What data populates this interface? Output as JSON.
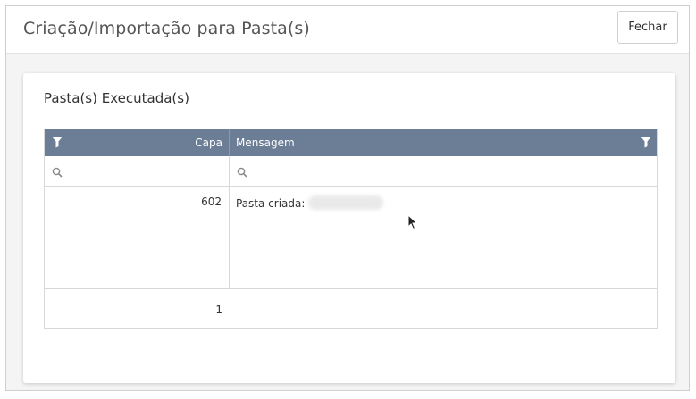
{
  "modal": {
    "title": "Criação/Importação para Pasta(s)",
    "close_label": "Fechar"
  },
  "panel": {
    "title": "Pasta(s) Executada(s)"
  },
  "grid": {
    "columns": [
      "Capa",
      "Mensagem"
    ],
    "filters": {
      "capa_value": "",
      "mensagem_value": ""
    },
    "rows": [
      {
        "capa": "602",
        "mensagem": "Pasta criada:"
      }
    ],
    "footer_count": "1"
  },
  "colors": {
    "header_bg": "#6c7d96",
    "body_bg": "#f4f4f4"
  },
  "icons": [
    "filter-icon",
    "search-icon",
    "mouse-cursor-icon"
  ]
}
